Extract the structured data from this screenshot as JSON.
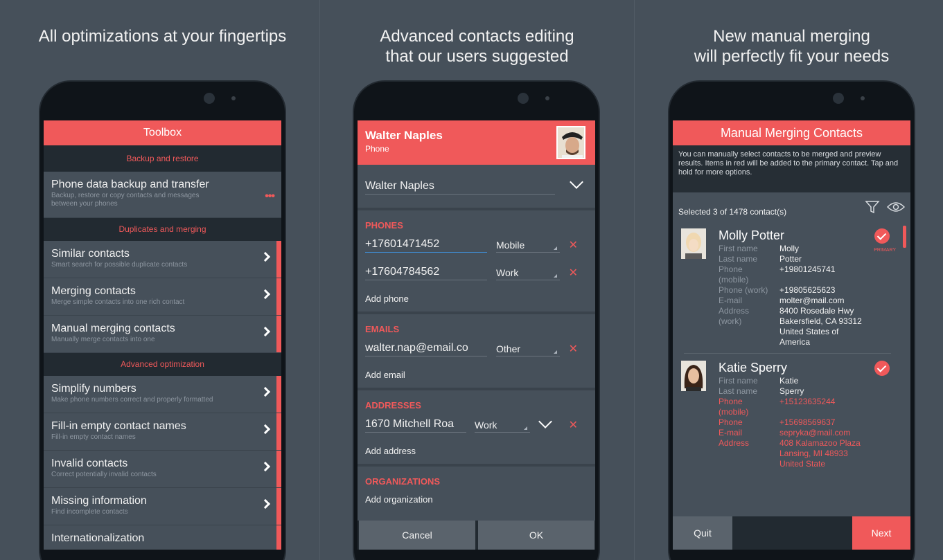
{
  "panel1": {
    "caption": "All optimizations at your fingertips",
    "header": "Toolbox",
    "sections": [
      "Backup and restore",
      "Duplicates and merging",
      "Advanced optimization"
    ],
    "items": [
      {
        "title": "Phone data backup and transfer",
        "subtitle": "Backup, restore or copy contacts and messages",
        "subtitle2": "between your phones"
      },
      {
        "title": "Similar contacts",
        "subtitle": "Smart search for possible duplicate contacts"
      },
      {
        "title": "Merging contacts",
        "subtitle": "Merge simple contacts into one rich contact"
      },
      {
        "title": "Manual merging contacts",
        "subtitle": "Manually merge contacts into one"
      },
      {
        "title": "Simplify numbers",
        "subtitle": "Make phone numbers correct and properly formatted"
      },
      {
        "title": "Fill-in empty contact names",
        "subtitle": "Fill-in empty contact names"
      },
      {
        "title": "Invalid contacts",
        "subtitle": "Correct potentially invalid contacts"
      },
      {
        "title": "Missing information",
        "subtitle": "Find incomplete contacts"
      },
      {
        "title": "Internationalization",
        "subtitle": ""
      }
    ]
  },
  "panel2": {
    "caption_line1": "Advanced contacts editing",
    "caption_line2": "that our users suggested",
    "header_name": "Walter Naples",
    "header_sub": "Phone",
    "name_field": "Walter Naples",
    "phones_label": "PHONES",
    "phones": [
      {
        "value": "+17601471452",
        "type": "Mobile"
      },
      {
        "value": "+17604784562",
        "type": "Work"
      }
    ],
    "add_phone": "Add phone",
    "emails_label": "EMAILS",
    "emails": [
      {
        "value": "walter.nap@email.co",
        "type": "Other"
      }
    ],
    "add_email": "Add email",
    "addresses_label": "ADDRESSES",
    "addresses": [
      {
        "value": "1670 Mitchell Roa",
        "type": "Work"
      }
    ],
    "add_address": "Add address",
    "organizations_label": "ORGANIZATIONS",
    "add_organization": "Add organization",
    "cancel": "Cancel",
    "ok": "OK"
  },
  "panel3": {
    "caption_line1": "New manual merging",
    "caption_line2": "will perfectly fit your needs",
    "header": "Manual Merging Contacts",
    "description": "You can manually select contacts to be merged and preview results. Items in red will be added to the primary contact. Tap and hold for more options.",
    "selected": "Selected 3 of 1478 contact(s)",
    "primary_label": "PRIMARY",
    "contact1": {
      "name": "Molly Potter",
      "fields": [
        {
          "k": "First name",
          "v": "Molly"
        },
        {
          "k": "Last name",
          "v": "Potter"
        },
        {
          "k": "Phone (mobile)",
          "v": "+19801245741"
        },
        {
          "k": "Phone (work)",
          "v": "+19805625623"
        },
        {
          "k": "E-mail",
          "v": "molter@mail.com"
        },
        {
          "k": "Address (work)",
          "v": "8400 Rosedale Hwy Bakersfield, CA 93312 United States of America"
        }
      ]
    },
    "contact2": {
      "name": "Katie Sperry",
      "fields": [
        {
          "k": "First name",
          "v": "Katie"
        },
        {
          "k": "Last name",
          "v": "Sperry"
        },
        {
          "k": "Phone (mobile)",
          "v": "+15123635244"
        },
        {
          "k": "Phone",
          "v": "+15698569637"
        },
        {
          "k": "E-mail",
          "v": "sepryka@mail.com"
        },
        {
          "k": "Address",
          "v": "408 Kalamazoo Plaza Lansing, MI 48933 United State"
        }
      ]
    },
    "quit": "Quit",
    "next": "Next"
  },
  "colors": {
    "accent": "#f0595a",
    "background": "#46505a",
    "dark": "#222a31"
  }
}
